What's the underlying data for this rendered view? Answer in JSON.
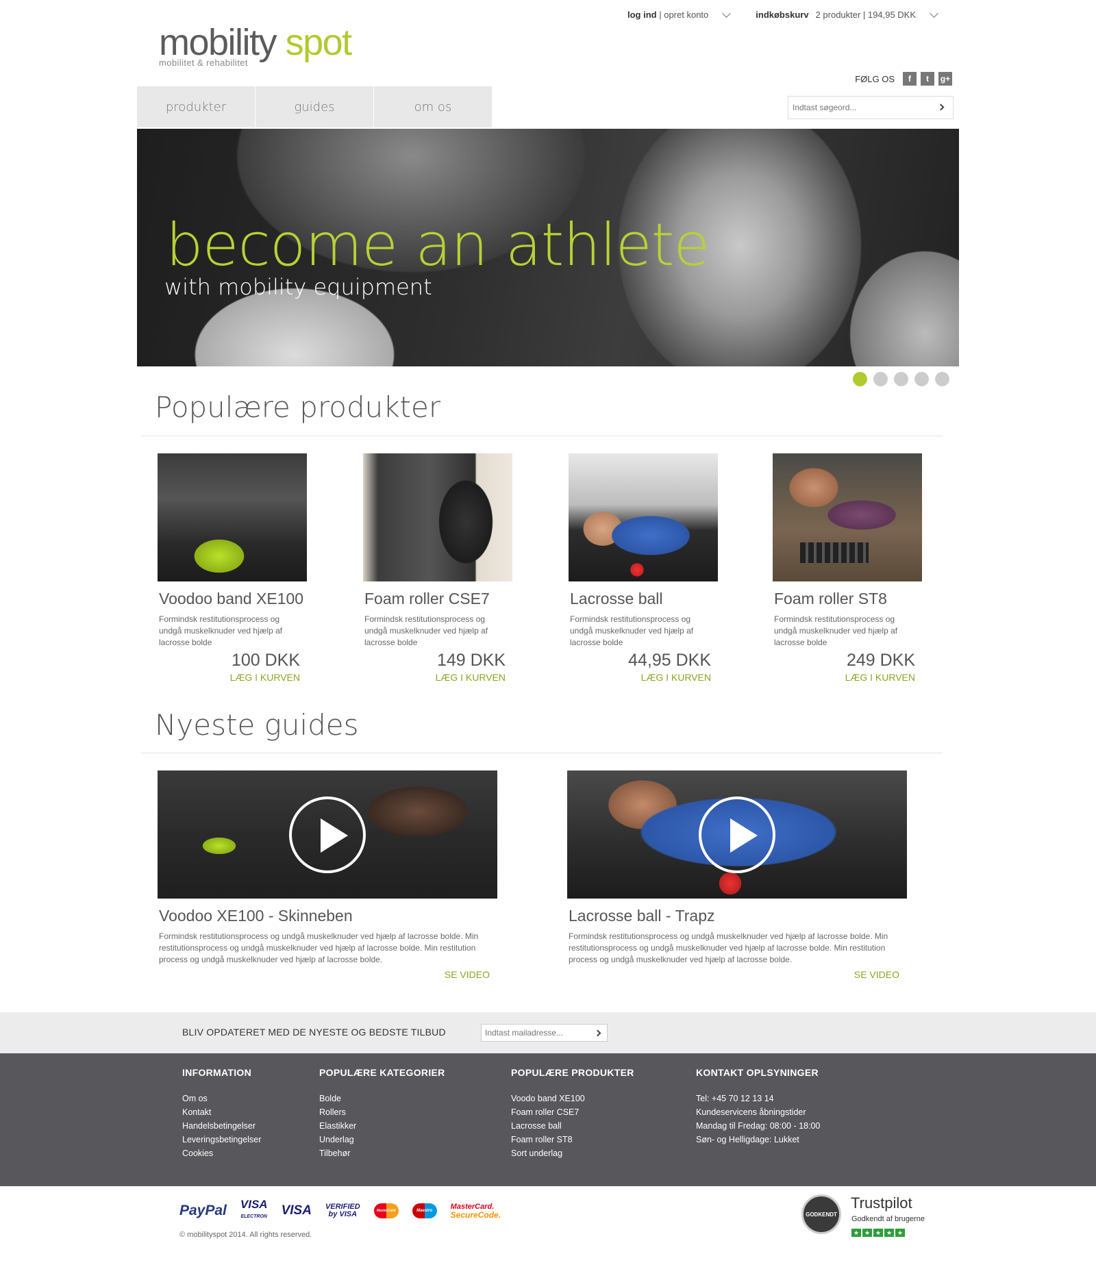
{
  "topbar": {
    "login": "log ind",
    "sep1": " | ",
    "create": "opret konto",
    "cart_label": "indkøbskurv",
    "cart_info": "2 produkter | 194,95 DKK"
  },
  "logo": {
    "word1": "mobility",
    "word2": "spot",
    "tagline": "mobilitet & rehabilitet"
  },
  "social": {
    "label": "FØLG OS",
    "facebook": "f",
    "twitter": "t",
    "google": "g+"
  },
  "nav": {
    "tabs": [
      "produkter",
      "guides",
      "om os"
    ]
  },
  "search": {
    "placeholder": "Indtast søgeord..."
  },
  "hero": {
    "headline": "become an athlete",
    "subline": "with mobility equipment",
    "slides": 5,
    "active_slide": 1
  },
  "popular": {
    "title": "Populære produkter",
    "items": [
      {
        "name": "Voodoo band XE100",
        "desc": "Formindsk restitutionsprocess og undgå muskelknuder ved hjælp af lacrosse bolde",
        "price": "100 DKK",
        "cta": "LÆG I KURVEN"
      },
      {
        "name": "Foam roller CSE7",
        "desc": "Formindsk restitutionsprocess og undgå muskelknuder ved hjælp af lacrosse bolde",
        "price": "149 DKK",
        "cta": "LÆG I KURVEN"
      },
      {
        "name": "Lacrosse ball",
        "desc": "Formindsk restitutionsprocess og undgå muskelknuder ved hjælp af lacrosse bolde",
        "price": "44,95 DKK",
        "cta": "LÆG I KURVEN"
      },
      {
        "name": "Foam roller ST8",
        "desc": "Formindsk restitutionsprocess og undgå muskelknuder ved hjælp af lacrosse bolde",
        "price": "249 DKK",
        "cta": "LÆG I KURVEN"
      }
    ]
  },
  "guides": {
    "title": "Nyeste guides",
    "items": [
      {
        "name": "Voodoo XE100 - Skinneben",
        "desc": "Formindsk restitutionsprocess og undgå muskelknuder ved hjælp af lacrosse bolde. Min restitutionsprocess og undgå muskelknuder ved hjælp af lacrosse bolde.  Min restitution process og undgå muskelknuder ved hjælp af lacrosse bolde.",
        "cta": "SE VIDEO"
      },
      {
        "name": "Lacrosse ball - Trapz",
        "desc": "Formindsk restitutionsprocess og undgå muskelknuder ved hjælp af lacrosse bolde. Min restitutionsprocess og undgå muskelknuder ved hjælp af lacrosse bolde.  Min restitution process og undgå muskelknuder ved hjælp af lacrosse bolde.",
        "cta": "SE VIDEO"
      }
    ]
  },
  "newsletter": {
    "text": "BLIV OPDATERET MED DE NYESTE OG BEDSTE TILBUD",
    "placeholder": "Indtast mailadresse..."
  },
  "footer": {
    "info": {
      "title": "INFORMATION",
      "links": [
        "Om os",
        "Kontakt",
        "Handelsbetingelser",
        "Leveringsbetingelser",
        "Cookies"
      ]
    },
    "categories": {
      "title": "POPULÆRE KATEGORIER",
      "links": [
        "Bolde",
        "Rollers",
        "Elastikker",
        "Underlag",
        "Tilbehør"
      ]
    },
    "products": {
      "title": "POPULÆRE PRODUKTER",
      "links": [
        "Voodo band XE100",
        "Foam roller CSE7",
        "Lacrosse ball",
        "Foam roller ST8",
        "Sort underlag"
      ]
    },
    "contact": {
      "title": "KONTAKT OPLSYNINGER",
      "lines": [
        "Tel: +45 70 12 13 14",
        "Kundeservicens åbningstider",
        "Mandag til Fredag: 08:00 - 18:00",
        "Søn- og Helligdage: Lukket"
      ]
    }
  },
  "payment": {
    "paypal": "PayPal",
    "visa_electron": "VISA",
    "visa_electron_sub": "ELECTRON",
    "visa": "VISA",
    "verified": "VERIFIED",
    "verified_sub": "by VISA",
    "mastercard": "MasterCard",
    "maestro": "Maestro",
    "securecode": "MasterCard.",
    "securecode_sub": "SecureCode."
  },
  "copyright": "© mobilityspot 2014. All rights reserved.",
  "trustpilot": {
    "name": "Trustpilot",
    "sub": "Godkendt af brugerne",
    "seal": "GODKENDT",
    "stars": 5
  },
  "colors": {
    "accent": "#b2c930",
    "cta": "#8ea221",
    "footer_bg": "#58585c",
    "nav_bg": "#e8e8e8"
  }
}
